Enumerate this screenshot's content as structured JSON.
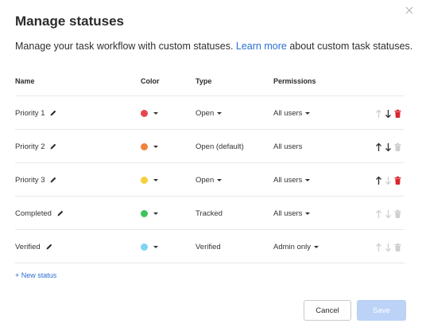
{
  "dialog": {
    "title": "Manage statuses",
    "subtitle_before": "Manage your task workflow with custom statuses.",
    "learn_more": "Learn more",
    "subtitle_after": "about custom task statuses."
  },
  "table": {
    "headers": {
      "name": "Name",
      "color": "Color",
      "type": "Type",
      "permissions": "Permissions"
    },
    "rows": [
      {
        "name": "Priority 1",
        "color": "#e8464e",
        "type": "Open",
        "type_dropdown": true,
        "permissions": "All users",
        "perm_dropdown": true,
        "up_enabled": false,
        "down_enabled": true,
        "delete_enabled": true
      },
      {
        "name": "Priority 2",
        "color": "#f0833a",
        "type": "Open (default)",
        "type_dropdown": false,
        "permissions": "All users",
        "perm_dropdown": false,
        "up_enabled": true,
        "down_enabled": true,
        "delete_enabled": false
      },
      {
        "name": "Priority 3",
        "color": "#f7cf3a",
        "type": "Open",
        "type_dropdown": true,
        "permissions": "All users",
        "perm_dropdown": true,
        "up_enabled": true,
        "down_enabled": false,
        "delete_enabled": true
      },
      {
        "name": "Completed",
        "color": "#3cc45a",
        "type": "Tracked",
        "type_dropdown": false,
        "permissions": "All users",
        "perm_dropdown": true,
        "up_enabled": false,
        "down_enabled": false,
        "delete_enabled": false
      },
      {
        "name": "Verified",
        "color": "#7fd2f5",
        "type": "Verified",
        "type_dropdown": false,
        "permissions": "Admin only",
        "perm_dropdown": true,
        "up_enabled": false,
        "down_enabled": false,
        "delete_enabled": false
      }
    ]
  },
  "new_status_label": "+ New status",
  "buttons": {
    "cancel": "Cancel",
    "save": "Save"
  },
  "colors": {
    "link": "#2a6fd1",
    "delete": "#d9262c",
    "disabled": "#cfcfcf",
    "save_bg": "#bcd3f7"
  }
}
